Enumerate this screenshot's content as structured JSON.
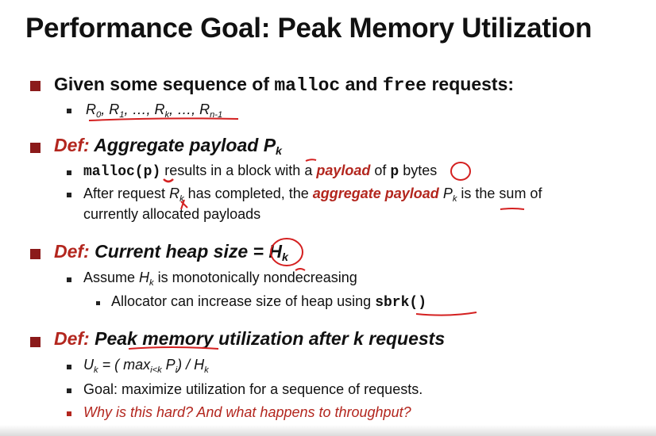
{
  "title": "Performance Goal: Peak Memory Utilization",
  "b1": {
    "t1": "Given some sequence of ",
    "code1": "malloc",
    "t2": " and ",
    "code2": "free",
    "t3": " requests:",
    "sub": {
      "R": "R",
      "s0": "0",
      "s1": "1",
      "dots": "…",
      "sk": "k",
      "sn": "n-1",
      "sep": ", "
    }
  },
  "b2": {
    "def": "Def:",
    "head": " Aggregate payload P",
    "head_sub": "k",
    "s1": {
      "code1": "malloc(",
      "code2": "p",
      "code3": ")",
      "t1": " results in a block with a ",
      "payload": "payload",
      "t2": " of ",
      "code4": "p",
      "t3": " bytes"
    },
    "s2": {
      "t1": "After request ",
      "R": "R",
      "Rk": "k",
      "t2": " has completed, the ",
      "agg": "aggregate payload",
      "P": "P",
      "Pk": "k",
      "t3": " is the sum of",
      "t4": "currently allocated payloads"
    }
  },
  "b3": {
    "def": "Def:",
    "head": " Current heap size = ",
    "H": "H",
    "Hk": "k",
    "s1": {
      "t1": "Assume ",
      "H": "H",
      "Hk": "k",
      "t2": " is monotonically nondecreasing"
    },
    "s2": {
      "t1": "Allocator can increase size of heap using ",
      "code": "sbrk()"
    }
  },
  "b4": {
    "def": "Def:",
    "head": " Peak memory utilization after k requests",
    "s1": {
      "U": "U",
      "Uk": "k",
      "t1": " = ( max",
      "sub": "i<k",
      "P": " P",
      "Pi": "i",
      "t2": ") / ",
      "H": "H",
      "Hk": "k"
    },
    "s2": "Goal: maximize utilization for a sequence of requests.",
    "s3": "Why is this hard? And what happens to throughput?"
  }
}
